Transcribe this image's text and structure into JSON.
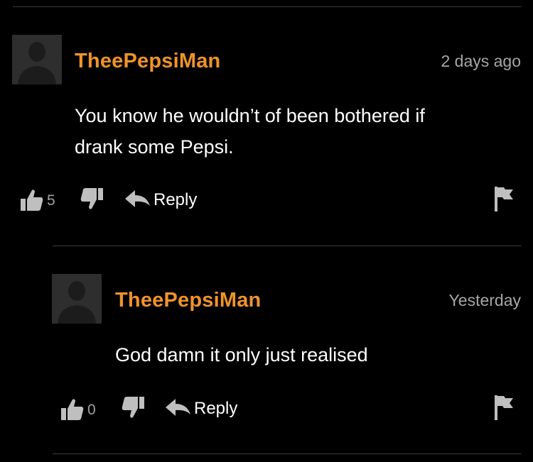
{
  "comments": [
    {
      "username": "TheePepsiMan",
      "timestamp": "2 days ago",
      "body_line1": "You know he wouldn’t of been bothered if",
      "body_line2": "drank some Pepsi.",
      "likes": "5",
      "reply_label": "Reply"
    },
    {
      "username": "TheePepsiMan",
      "timestamp": "Yesterday",
      "body_line1": "God damn it only just realised",
      "likes": "0",
      "reply_label": "Reply"
    }
  ],
  "colors": {
    "background": "#000000",
    "username": "#f0932b",
    "timestamp": "#a6a6a6",
    "text": "#ffffff",
    "icon": "#bfbfbf",
    "avatar": "#2e2e2e"
  },
  "icons": [
    "avatar-placeholder-icon",
    "thumbs-up-icon",
    "thumbs-down-icon",
    "reply-arrow-icon",
    "flag-icon"
  ]
}
